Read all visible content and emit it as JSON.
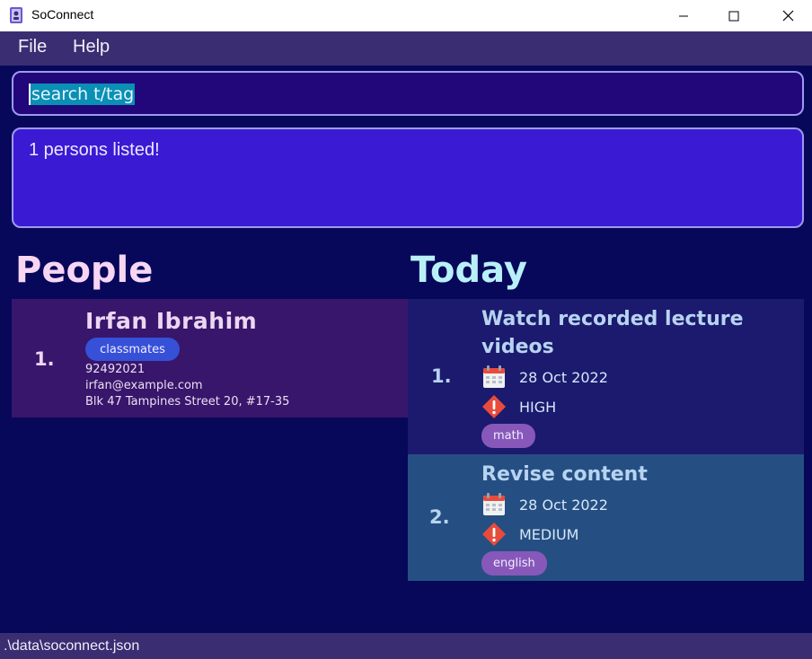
{
  "window": {
    "title": "SoConnect"
  },
  "menu": {
    "file": "File",
    "help": "Help"
  },
  "command": {
    "value": "search t/tag"
  },
  "result": {
    "text": "1 persons listed!"
  },
  "people": {
    "heading": "People",
    "items": [
      {
        "index": "1.",
        "name": "Irfan Ibrahim",
        "tag": "classmates",
        "phone": "92492021",
        "email": "irfan@example.com",
        "address": "Blk 47 Tampines Street 20, #17-35"
      }
    ]
  },
  "today": {
    "heading": "Today",
    "items": [
      {
        "index": "1.",
        "title_line1": "Watch recorded lecture",
        "title_line2": "videos",
        "date": "28 Oct 2022",
        "priority": "HIGH",
        "tag": "math"
      },
      {
        "index": "2.",
        "title_line1": "Revise content",
        "date": "28 Oct 2022",
        "priority": "MEDIUM",
        "tag": "english"
      }
    ]
  },
  "status": {
    "path": ".\\data\\soconnect.json"
  },
  "colors": {
    "background": "#07085a",
    "menubar": "#3a2d72",
    "command_box": "#21077a",
    "result_box": "#3b1ad4",
    "person_card": "#37166b",
    "task_card_1": "#1b1a6e",
    "task_card_2": "#254f82",
    "people_heading": "#f6d6f3",
    "today_heading": "#b9f0f8",
    "priority_icon": "#e84b3c"
  },
  "icons": [
    "app-icon",
    "minimize-icon",
    "maximize-icon",
    "close-icon",
    "calendar-icon",
    "priority-icon"
  ]
}
